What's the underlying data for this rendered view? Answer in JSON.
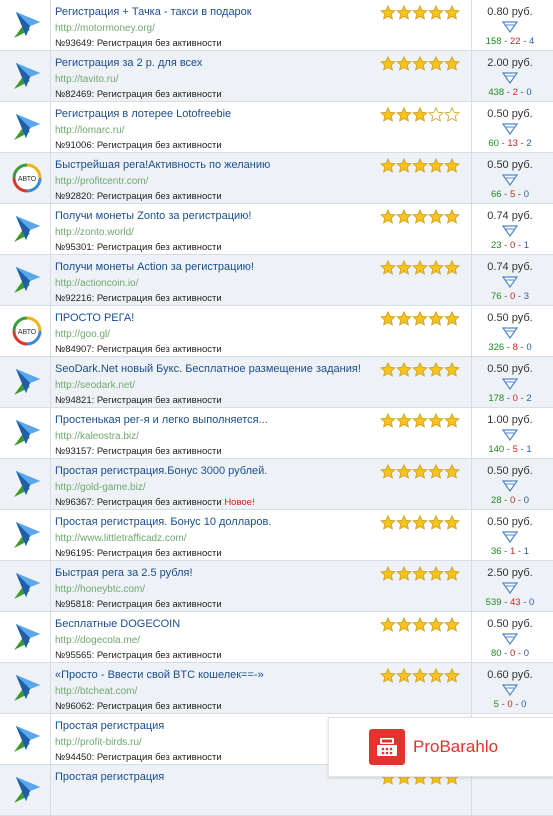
{
  "tasks": [
    {
      "title": "Регистрация + Тачка - такси в подарок",
      "url": "http://motormoney.org/",
      "number": "№93649:",
      "status": "Регистрация без активности",
      "is_new": "",
      "icon": "clicker-arrow-icon",
      "rating": 5,
      "price": "0.80 руб.",
      "counts": {
        "done": "158",
        "rejected": "22",
        "pending": "4"
      }
    },
    {
      "title": "Регистрация за 2 р. для всех",
      "url": "http://tavito.ru/",
      "number": "№82469:",
      "status": "Регистрация без активности",
      "is_new": "",
      "icon": "clicker-arrow-icon",
      "rating": 5,
      "price": "2.00 руб.",
      "counts": {
        "done": "438",
        "rejected": "2",
        "pending": "0"
      }
    },
    {
      "title": "Регистрация в лотерее Lotofreebie",
      "url": "http://lomarc.ru/",
      "number": "№91006:",
      "status": "Регистрация без активности",
      "is_new": "",
      "icon": "clicker-arrow-icon",
      "rating": 3,
      "price": "0.50 руб.",
      "counts": {
        "done": "60",
        "rejected": "13",
        "pending": "2"
      }
    },
    {
      "title": "Быстрейшая рега!Активность по желанию",
      "url": "http://profitcentr.com/",
      "number": "№92820:",
      "status": "Регистрация без активности",
      "is_new": "",
      "icon": "auto-badge-icon",
      "rating": 5,
      "price": "0.50 руб.",
      "counts": {
        "done": "66",
        "rejected": "5",
        "pending": "0"
      }
    },
    {
      "title": "Получи монеты Zonto за регистрацию!",
      "url": "http://zonto.world/",
      "number": "№95301:",
      "status": "Регистрация без активности",
      "is_new": "",
      "icon": "clicker-arrow-icon",
      "rating": 5,
      "price": "0.74 руб.",
      "counts": {
        "done": "23",
        "rejected": "0",
        "pending": "1"
      }
    },
    {
      "title": "Получи монеты Action за регистрацию!",
      "url": "http://actioncoin.io/",
      "number": "№92216:",
      "status": "Регистрация без активности",
      "is_new": "",
      "icon": "clicker-arrow-icon",
      "rating": 5,
      "price": "0.74 руб.",
      "counts": {
        "done": "76",
        "rejected": "0",
        "pending": "3"
      }
    },
    {
      "title": "ПРОСТО РЕГА!",
      "url": "http://goo.gl/",
      "number": "№84907:",
      "status": "Регистрация без активности",
      "is_new": "",
      "icon": "auto-badge-icon",
      "rating": 5,
      "price": "0.50 руб.",
      "counts": {
        "done": "326",
        "rejected": "8",
        "pending": "0"
      }
    },
    {
      "title": "SeoDark.Net новый Букс. Бесплатное размещение задания!",
      "url": "http://seodark.net/",
      "number": "№94821:",
      "status": "Регистрация без активности",
      "is_new": "",
      "icon": "clicker-arrow-icon",
      "rating": 5,
      "price": "0.50 руб.",
      "counts": {
        "done": "178",
        "rejected": "0",
        "pending": "2"
      }
    },
    {
      "title": "Простенькая рег-я и легко выполняется...",
      "url": "http://kaleostra.biz/",
      "number": "№93157:",
      "status": "Регистрация без активности",
      "is_new": "",
      "icon": "clicker-arrow-icon",
      "rating": 5,
      "price": "1.00 руб.",
      "counts": {
        "done": "140",
        "rejected": "5",
        "pending": "1"
      }
    },
    {
      "title": "Простая регистрация.Бонус 3000 рублей.",
      "url": "http://gold-game.biz/",
      "number": "№96367:",
      "status": "Регистрация без активности",
      "is_new": "Новое!",
      "icon": "clicker-arrow-icon",
      "rating": 5,
      "price": "0.50 руб.",
      "counts": {
        "done": "28",
        "rejected": "0",
        "pending": "0"
      }
    },
    {
      "title": "Простая регистрация. Бонус 10 долларов.",
      "url": "http://www.littletrafficadz.com/",
      "number": "№96195:",
      "status": "Регистрация без активности",
      "is_new": "",
      "icon": "clicker-arrow-icon",
      "rating": 5,
      "price": "0.50 руб.",
      "counts": {
        "done": "36",
        "rejected": "1",
        "pending": "1"
      }
    },
    {
      "title": "Быстрая рега за 2.5 рубля!",
      "url": "http://honeybtc.com/",
      "number": "№95818:",
      "status": "Регистрация без активности",
      "is_new": "",
      "icon": "clicker-arrow-icon",
      "rating": 5,
      "price": "2.50 руб.",
      "counts": {
        "done": "539",
        "rejected": "43",
        "pending": "0"
      }
    },
    {
      "title": "Бесплатные DOGECOIN",
      "url": "http://dogecola.me/",
      "number": "№95565:",
      "status": "Регистрация без активности",
      "is_new": "",
      "icon": "clicker-arrow-icon",
      "rating": 5,
      "price": "0.50 руб.",
      "counts": {
        "done": "80",
        "rejected": "0",
        "pending": "0"
      }
    },
    {
      "title": "«Просто - Ввести свой BTC кошелек==-»",
      "url": "http://btcheat.com/",
      "number": "№96062:",
      "status": "Регистрация без активности",
      "is_new": "",
      "icon": "clicker-arrow-icon",
      "rating": 5,
      "price": "0.60 руб.",
      "counts": {
        "done": "5",
        "rejected": "0",
        "pending": "0"
      }
    },
    {
      "title": "Простая регистрация",
      "url": "http://profit-birds.ru/",
      "number": "№94450:",
      "status": "Регистрация без активности",
      "is_new": "",
      "icon": "clicker-arrow-icon",
      "rating": 5,
      "price": "",
      "counts": {
        "done": "",
        "rejected": "",
        "pending": ""
      }
    },
    {
      "title": "Простая регистрация",
      "url": "",
      "number": "",
      "status": "",
      "is_new": "",
      "icon": "clicker-arrow-icon",
      "rating": 5,
      "price": "",
      "counts": {
        "done": "",
        "rejected": "",
        "pending": ""
      }
    }
  ],
  "separator": " - ",
  "ad": {
    "brand": "ProBarahlo",
    "icon": "cash-register-icon"
  },
  "colors": {
    "link": "#1a4e8c",
    "url": "#6fa86f",
    "done": "#1f8a1f",
    "rejected": "#d42020",
    "pending": "#2a5db0",
    "star": "#f7c21e",
    "brand": "#e3332e"
  }
}
